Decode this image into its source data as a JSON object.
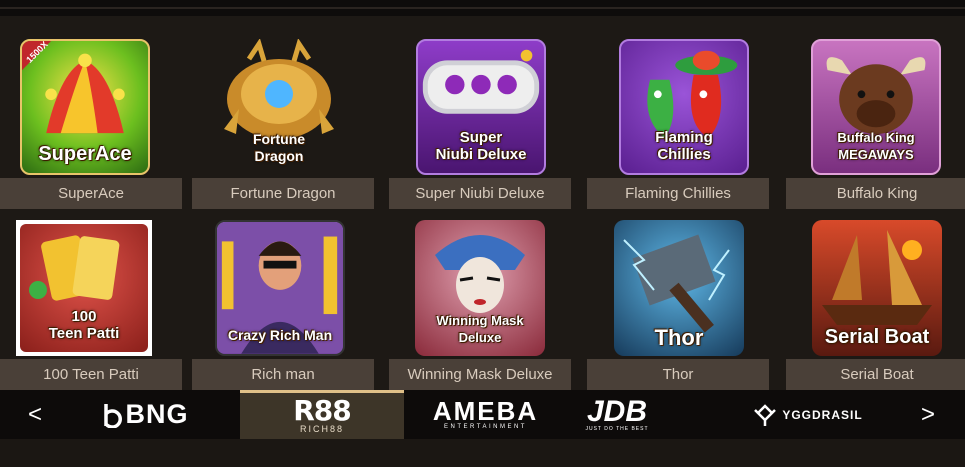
{
  "games": [
    {
      "name": "SuperAce",
      "art_title": "SuperAce",
      "badge": "1500X",
      "accent": "#f2c230"
    },
    {
      "name": "Fortune Dragon",
      "art_title": "Fortune\nDragon",
      "accent": "#d9a43a"
    },
    {
      "name": "Super Niubi Deluxe",
      "art_title": "Super\nNiubi Deluxe",
      "accent": "#7b2fb0"
    },
    {
      "name": "Flaming Chillies",
      "art_title": "Flaming\nChillies",
      "accent": "#7a3fb8"
    },
    {
      "name": "Buffalo King",
      "art_title": "Buffalo King\nMEGAWAYS",
      "accent": "#b04a9a"
    },
    {
      "name": "100 Teen Patti",
      "art_title": "100\nTeen Patti",
      "accent": "#c0392b"
    },
    {
      "name": "Rich man",
      "art_title": "Crazy Rich Man",
      "accent": "#8e44ad"
    },
    {
      "name": "Winning Mask Deluxe",
      "art_title": "Winning Mask\nDeluxe",
      "accent": "#c0392b"
    },
    {
      "name": "Thor",
      "art_title": "Thor",
      "accent": "#2e86c1"
    },
    {
      "name": "Serial Boat",
      "art_title": "Serial Boat",
      "accent": "#c0392b"
    }
  ],
  "providers": {
    "prev": "<",
    "next": ">",
    "items": [
      {
        "name": "BNG",
        "icon": "bng-logo"
      },
      {
        "name": "R88",
        "sub": "RICH88",
        "icon": "rich88-logo",
        "active": true
      },
      {
        "name": "AMEBA",
        "sub": "ENTERTAINMENT",
        "icon": "ameba-logo"
      },
      {
        "name": "JDB",
        "sub": "JUST DO THE BEST",
        "icon": "jdb-logo"
      },
      {
        "name": "YGGDRASIL",
        "icon": "yggdrasil-logo"
      }
    ]
  }
}
